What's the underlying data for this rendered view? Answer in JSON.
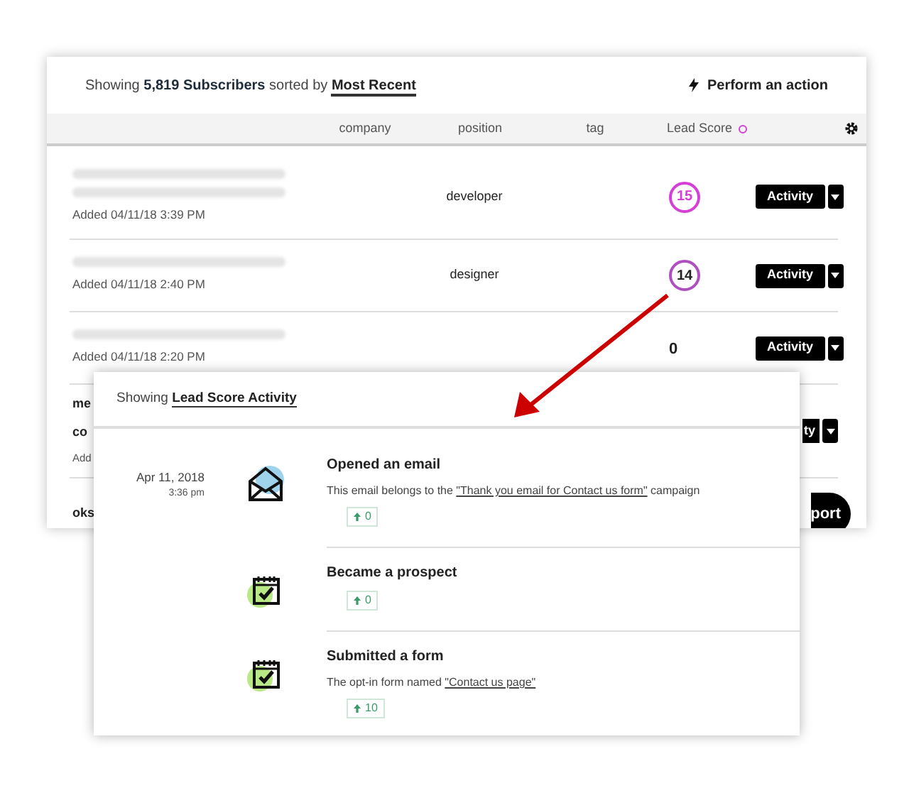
{
  "header": {
    "prefix": "Showing",
    "count": "5,819 Subscribers",
    "middle": "sorted by",
    "sort": "Most Recent",
    "action": "Perform an action"
  },
  "columns": [
    "company",
    "position",
    "tag",
    "Lead Score"
  ],
  "rows": [
    {
      "name_lines": [],
      "added": "Added 04/11/18 3:39 PM",
      "position": "developer",
      "score": {
        "kind": "circle",
        "value": "15",
        "color": "#d63fd6"
      },
      "action": {
        "kind": "split",
        "label": "Activity"
      }
    },
    {
      "name_lines": [],
      "added": "Added 04/11/18 2:40 PM",
      "position": "designer",
      "score": {
        "kind": "circle",
        "value": "14",
        "color": "#b04fc0"
      },
      "action": {
        "kind": "split",
        "label": "Activity"
      }
    },
    {
      "name_lines": [],
      "added": "Added 04/11/18 2:20 PM",
      "score": {
        "kind": "plain",
        "value": "0"
      },
      "action": {
        "kind": "split",
        "label": "Activity"
      }
    },
    {
      "name_lines": [
        "me",
        "co"
      ],
      "added": "Add",
      "action": {
        "kind": "split",
        "label": "ty"
      }
    },
    {
      "name_lines": [
        "oks"
      ],
      "action": {
        "kind": "pill",
        "label": "port"
      }
    }
  ],
  "activity": {
    "prefix": "Showing",
    "title": "Lead Score Activity",
    "items": [
      {
        "date": "Apr 11, 2018",
        "time": "3:36 pm",
        "kind": "email",
        "title": "Opened an email",
        "description": {
          "before": "This email belongs to the",
          "link": "\"Thank you email for Contact us form\"",
          "after": "campaign"
        },
        "score": "0"
      },
      {
        "kind": "calendar",
        "title": "Became a prospect",
        "score": "0"
      },
      {
        "kind": "calendar",
        "title": "Submitted a form",
        "description": {
          "before": "The opt-in form named",
          "link": "\"Contact us page\""
        },
        "score": "10"
      }
    ]
  }
}
